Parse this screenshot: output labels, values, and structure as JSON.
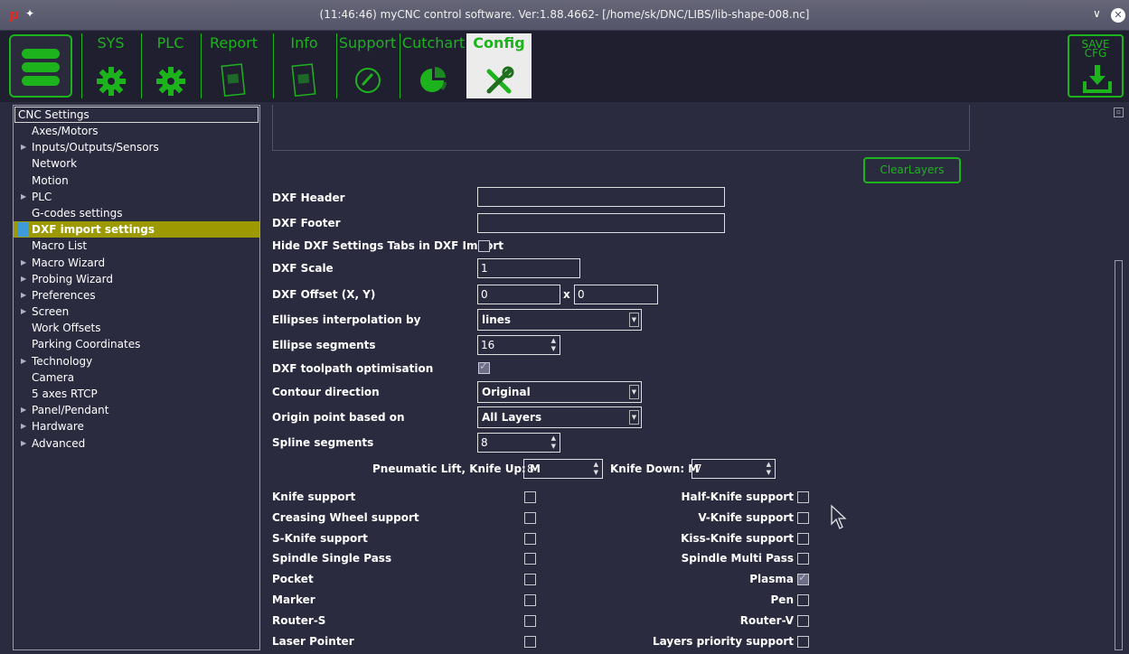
{
  "window": {
    "title": "(11:46:46) myCNC control software. Ver:1.88.4662- [/home/sk/DNC/LIBS/lib-shape-008.nc]",
    "app_icon": "μ",
    "pin_icon": "✦",
    "chevron_icon": "∨",
    "close_icon": "✕"
  },
  "toolbar": {
    "tabs": [
      {
        "label": "SYS",
        "icon": "gear-icon"
      },
      {
        "label": "PLC",
        "icon": "gear-icon"
      },
      {
        "label": "Report",
        "icon": "document-icon"
      },
      {
        "label": "Info",
        "icon": "document-icon"
      },
      {
        "label": "Support",
        "icon": "phone-icon"
      },
      {
        "label": "Cutchart",
        "icon": "pie-chart-icon"
      },
      {
        "label": "Config",
        "icon": "tools-icon"
      }
    ],
    "save_label_1": "SAVE",
    "save_label_2": "CFG",
    "accent": "#1db31d"
  },
  "sidebar": {
    "header": "CNC Settings",
    "items": [
      {
        "label": "Axes/Motors",
        "arrow": false
      },
      {
        "label": "Inputs/Outputs/Sensors",
        "arrow": true
      },
      {
        "label": "Network",
        "arrow": false
      },
      {
        "label": "Motion",
        "arrow": false
      },
      {
        "label": "PLC",
        "arrow": true
      },
      {
        "label": "G-codes settings",
        "arrow": false
      },
      {
        "label": "DXF import settings",
        "arrow": false,
        "selected": true
      },
      {
        "label": "Macro List",
        "arrow": false
      },
      {
        "label": "Macro Wizard",
        "arrow": true
      },
      {
        "label": "Probing Wizard",
        "arrow": true
      },
      {
        "label": "Preferences",
        "arrow": true
      },
      {
        "label": "Screen",
        "arrow": true
      },
      {
        "label": "Work Offsets",
        "arrow": false
      },
      {
        "label": "Parking Coordinates",
        "arrow": false
      },
      {
        "label": "Technology",
        "arrow": true
      },
      {
        "label": "Camera",
        "arrow": false
      },
      {
        "label": "5 axes RTCP",
        "arrow": false
      },
      {
        "label": "Panel/Pendant",
        "arrow": true
      },
      {
        "label": "Hardware",
        "arrow": true
      },
      {
        "label": "Advanced",
        "arrow": true
      }
    ]
  },
  "main": {
    "clear_layers": "ClearLayers",
    "dxf_header_label": "DXF Header",
    "dxf_header_value": "",
    "dxf_footer_label": "DXF Footer",
    "dxf_footer_value": "",
    "hide_tabs_label": "Hide DXF Settings Tabs in DXF Import",
    "hide_tabs_checked": false,
    "scale_label": "DXF Scale",
    "scale_value": "1",
    "offset_label": "DXF Offset (X, Y)",
    "offset_x": "0",
    "offset_sep": "x",
    "offset_y": "0",
    "ellipse_interp_label": "Ellipses interpolation by",
    "ellipse_interp_value": "lines",
    "ellipse_seg_label": "Ellipse segments",
    "ellipse_seg_value": "16",
    "toolpath_opt_label": "DXF toolpath optimisation",
    "toolpath_opt_checked": true,
    "contour_dir_label": "Contour direction",
    "contour_dir_value": "Original",
    "origin_label": "Origin point based on",
    "origin_value": "All Layers",
    "spline_label": "Spline segments",
    "spline_value": "8",
    "knife_up_label": "Pneumatic Lift, Knife Up: M",
    "knife_up_value": "8",
    "knife_down_label": "Knife Down: M",
    "knife_down_value": "7",
    "left_options": [
      {
        "label": "Knife support",
        "checked": false
      },
      {
        "label": "Creasing Wheel support",
        "checked": false
      },
      {
        "label": "S-Knife support",
        "checked": false
      },
      {
        "label": "Spindle Single Pass",
        "checked": false
      },
      {
        "label": "Pocket",
        "checked": false
      },
      {
        "label": "Marker",
        "checked": false
      },
      {
        "label": "Router-S",
        "checked": false
      },
      {
        "label": "Laser Pointer",
        "checked": false
      }
    ],
    "right_options": [
      {
        "label": "Half-Knife support",
        "checked": false
      },
      {
        "label": "V-Knife support",
        "checked": false
      },
      {
        "label": "Kiss-Knife support",
        "checked": false
      },
      {
        "label": "Spindle Multi Pass",
        "checked": false
      },
      {
        "label": "Plasma",
        "checked": true
      },
      {
        "label": "Pen",
        "checked": false
      },
      {
        "label": "Router-V",
        "checked": false
      },
      {
        "label": "Layers priority support",
        "checked": false
      }
    ]
  }
}
